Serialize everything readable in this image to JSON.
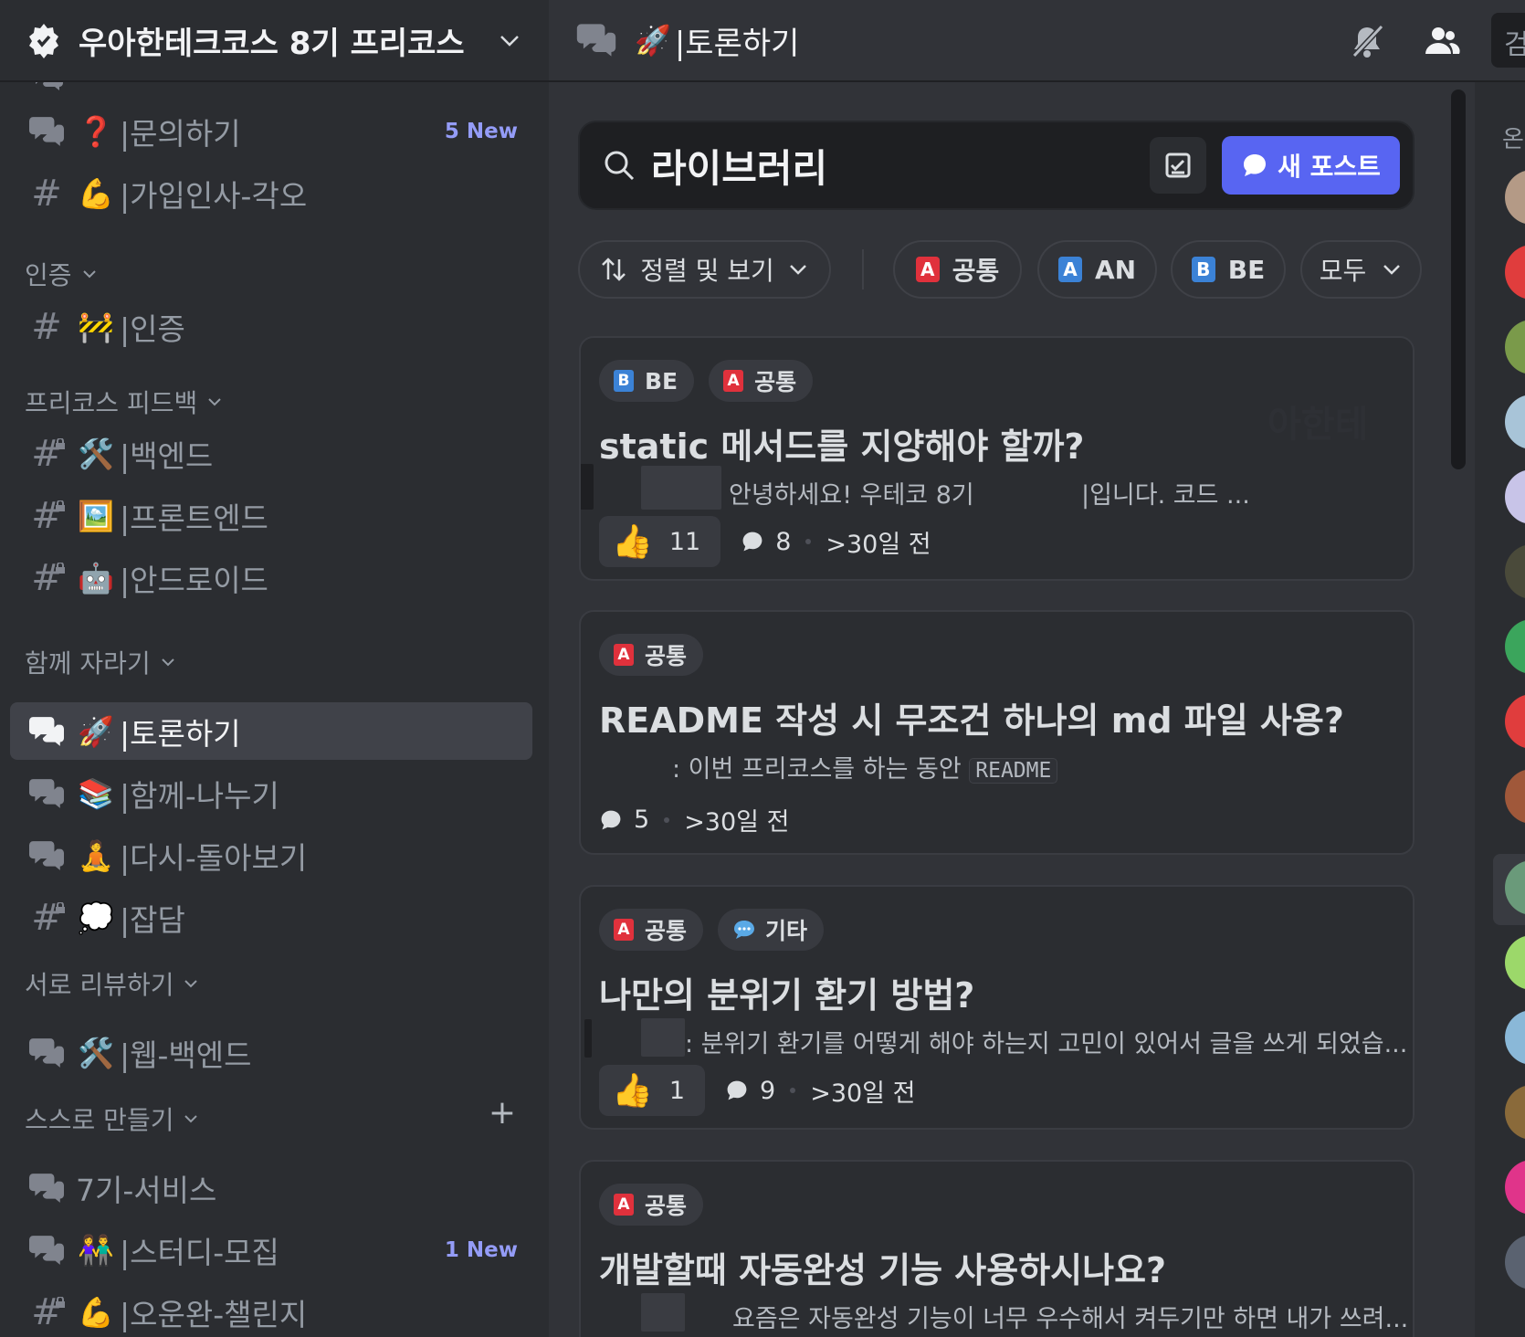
{
  "server": {
    "name": "우아한테크코스 8기 프리코스"
  },
  "sidebar": {
    "channels_top": [
      {
        "emoji": "❓",
        "label": "|문의하기",
        "type": "forum",
        "badge": "5 New"
      },
      {
        "emoji": "💪",
        "label": "|가입인사-각오",
        "type": "text"
      }
    ],
    "categories": [
      {
        "name": "인증",
        "channels": [
          {
            "emoji": "🚧",
            "label": "|인증",
            "type": "text"
          }
        ]
      },
      {
        "name": "프리코스 피드백",
        "channels": [
          {
            "emoji": "🛠️",
            "label": "|백엔드",
            "type": "text-locked"
          },
          {
            "emoji": "🖼️",
            "label": "|프론트엔드",
            "type": "text-locked"
          },
          {
            "emoji": "🤖",
            "label": "|안드로이드",
            "type": "text-locked"
          }
        ]
      },
      {
        "name": "함께 자라기",
        "channels": [
          {
            "emoji": "🚀",
            "label": "|토론하기",
            "type": "forum-locked",
            "active": true
          },
          {
            "emoji": "📚",
            "label": "|함께-나누기",
            "type": "forum-locked"
          },
          {
            "emoji": "🧘",
            "label": "|다시-돌아보기",
            "type": "forum-locked"
          },
          {
            "emoji": "💭",
            "label": "|잡담",
            "type": "text-locked"
          }
        ]
      },
      {
        "name": "서로 리뷰하기",
        "channels": [
          {
            "emoji": "🛠️",
            "label": "|웹-백엔드",
            "type": "forum-locked"
          }
        ]
      },
      {
        "name": "스스로 만들기",
        "channels": [
          {
            "emoji": "",
            "label": "7기-서비스",
            "type": "forum-locked"
          },
          {
            "emoji": "👫",
            "label": "|스터디-모집",
            "type": "forum-locked",
            "badge": "1 New"
          },
          {
            "emoji": "💪",
            "label": "|오운완-챌린지",
            "type": "text-locked"
          }
        ]
      }
    ]
  },
  "header": {
    "emoji": "🚀",
    "title": "|토론하기",
    "search_placeholder": "검"
  },
  "forum": {
    "search_value": "라이브러리",
    "new_post_label": "새 포스트",
    "sort_label": "정렬 및 보기",
    "filters": [
      {
        "letter": "A",
        "label": "공통",
        "color": "#e0313c"
      },
      {
        "letter": "A",
        "label": "AN",
        "color": "#3b82d6"
      },
      {
        "letter": "B",
        "label": "BE",
        "color": "#3b82d6"
      }
    ],
    "all_label": "모두",
    "posts": [
      {
        "tags": [
          {
            "letter": "B",
            "label": "BE"
          },
          {
            "letter": "A",
            "label": "공통"
          }
        ],
        "title": "static 메서드를 지양해야 할까?",
        "excerpt_a": "안녕하세요! 우테코 8기",
        "excerpt_b": "|입니다. 코드 ...",
        "reactions": "11",
        "comments": "8",
        "time": ">30일 전",
        "watermark": "아한테"
      },
      {
        "tags": [
          {
            "letter": "A",
            "label": "공통"
          }
        ],
        "title": "README 작성 시 무조건 하나의 md 파일 사용?",
        "excerpt_a": ": 이번 프리코스를 하는 동안",
        "excerpt_code": "README",
        "comments": "5",
        "time": ">30일 전"
      },
      {
        "tags": [
          {
            "letter": "A",
            "label": "공통"
          },
          {
            "letter": "",
            "label": "기타"
          }
        ],
        "title": "나만의 분위기 환기 방법?",
        "excerpt_a": ": 분위기 환기를 어떻게 해야 하는지 고민이 있어서 글을 쓰게 되었습...",
        "reactions": "1",
        "comments": "9",
        "time": ">30일 전"
      },
      {
        "tags": [
          {
            "letter": "A",
            "label": "공통"
          }
        ],
        "title": "개발할때 자동완성 기능 사용하시나요?",
        "excerpt_a": "요즘은 자동완성 기능이 너무 우수해서 켜두기만 하면 내가 쓰려..."
      }
    ]
  },
  "members": {
    "header": "온"
  }
}
